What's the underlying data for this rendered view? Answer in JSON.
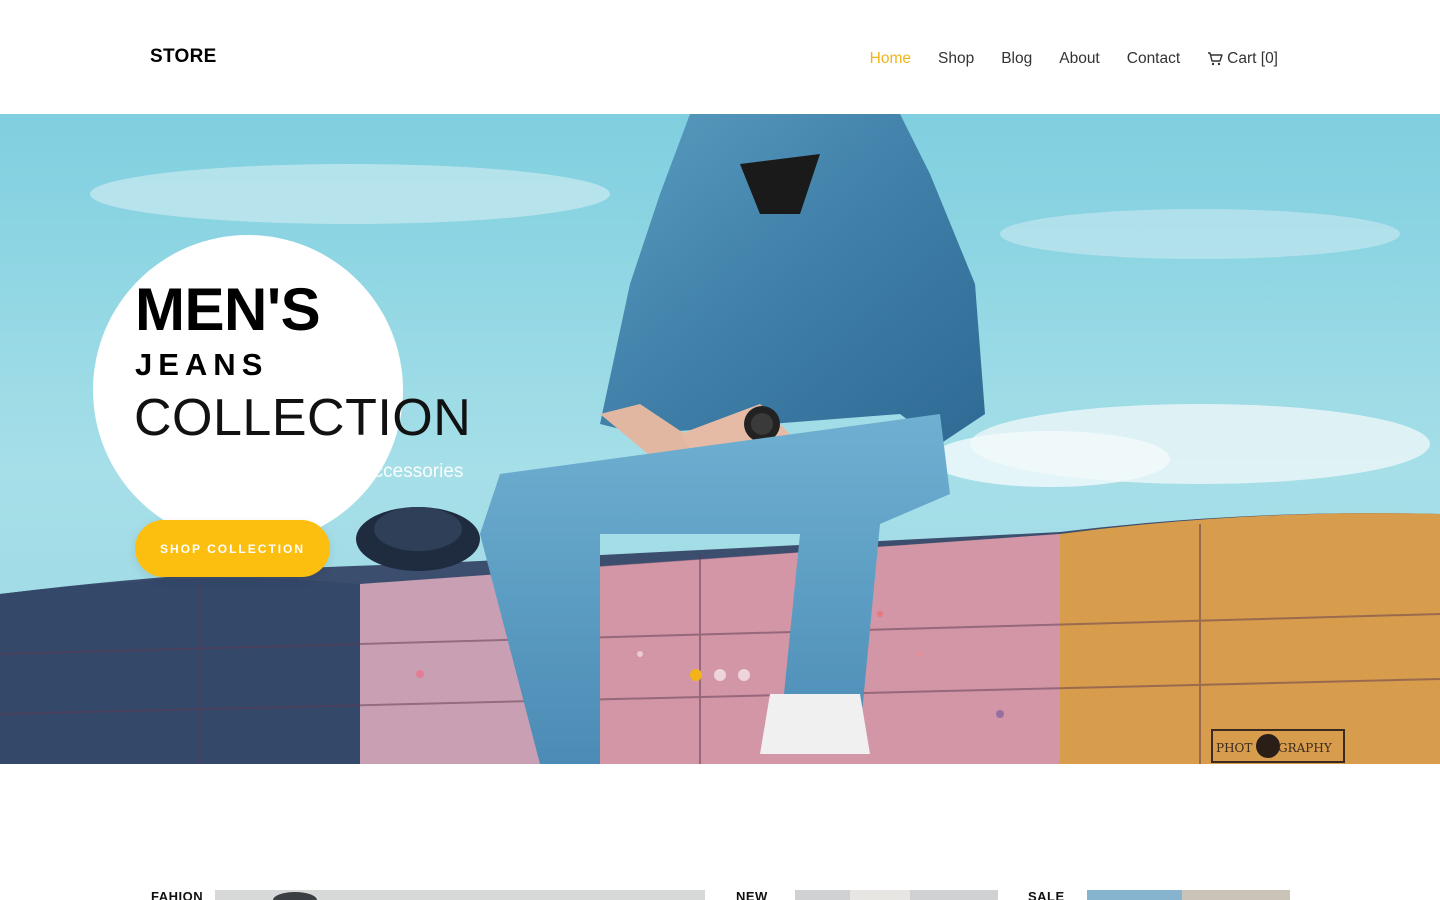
{
  "brand": {
    "logo": "STORE",
    "accent": "#f3b41b"
  },
  "nav": {
    "items": [
      {
        "label": "Home",
        "active": true
      },
      {
        "label": "Shop",
        "active": false
      },
      {
        "label": "Blog",
        "active": false
      },
      {
        "label": "About",
        "active": false
      },
      {
        "label": "Contact",
        "active": false
      }
    ],
    "cart": {
      "label": "Cart [0]",
      "icon": "cart-icon"
    }
  },
  "hero": {
    "title_line1": "MEN'S",
    "title_line2": "JEANS",
    "title_line3": "COLLECTION",
    "subtitle": "New stylish shirts, pants & Accessories",
    "button_label": "SHOP COLLECTION",
    "button_color": "#fdbf0f",
    "slides": {
      "count": 3,
      "active_index": 0
    },
    "watermark_text": "PHOTOGRAPHY"
  },
  "categories": [
    {
      "label": "FAHION"
    },
    {
      "label": "NEW"
    },
    {
      "label": "SALE"
    }
  ]
}
